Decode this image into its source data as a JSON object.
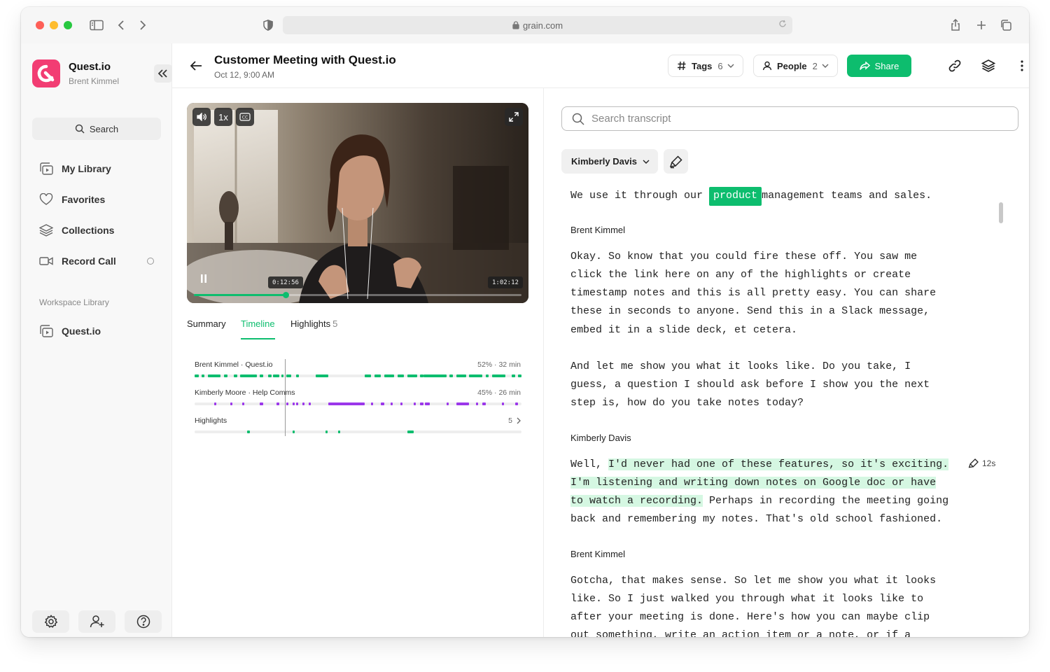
{
  "browser": {
    "url": "grain.com"
  },
  "sidebar": {
    "workspace_name": "Quest.io",
    "user_name": "Brent Kimmel",
    "search_label": "Search",
    "nav": [
      {
        "label": "My Library",
        "icon": "library-icon"
      },
      {
        "label": "Favorites",
        "icon": "heart-icon"
      },
      {
        "label": "Collections",
        "icon": "layers-icon"
      },
      {
        "label": "Record Call",
        "icon": "video-camera-icon"
      }
    ],
    "section_label": "Workspace Library",
    "workspace_items": [
      {
        "label": "Quest.io",
        "icon": "library-icon"
      }
    ]
  },
  "header": {
    "title": "Customer Meeting with Quest.io",
    "subtitle": "Oct 12, 9:00 AM",
    "tags_label": "Tags",
    "tags_count": "6",
    "people_label": "People",
    "people_count": "2",
    "share_label": "Share"
  },
  "video": {
    "speed_label": "1x",
    "current_time": "0:12:56",
    "duration": "1:02:12",
    "progress": 0.28
  },
  "tabs": [
    {
      "label": "Summary",
      "count": ""
    },
    {
      "label": "Timeline",
      "count": ""
    },
    {
      "label": "Highlights",
      "count": "5"
    }
  ],
  "timeline": {
    "rows": [
      {
        "label": "Brent Kimmel · Quest.io",
        "stat": "52% · 32 min"
      },
      {
        "label": "Kimberly Moore · Help Comms",
        "stat": "45% · 26 min"
      },
      {
        "label": "Highlights",
        "stat": "5"
      }
    ]
  },
  "transcript": {
    "search_placeholder": "Search transcript",
    "speaker_filter": "Kimberly Davis",
    "first_line": {
      "before": "We use it through our ",
      "tag": "product",
      "after": "management teams and sales."
    },
    "block1": {
      "speaker": "Brent Kimmel",
      "lines": [
        "Okay. So know that you could fire these off. You saw me",
        "click the link here on any of the highlights or create",
        "timestamp notes and this is all pretty easy. You can share",
        "these in seconds to anyone. Send this in a Slack message,",
        "embed it in a slide deck, et cetera.",
        "",
        "And let me show you what it looks like. Do you take, I",
        "guess, a question I should ask before I show you the next",
        "step is, how do you take notes today?"
      ]
    },
    "block2": {
      "speaker": "Kimberly Davis",
      "highlight_duration": "12s",
      "l1_plain": "Well, ",
      "l1_hl": "I'd never had one of these features, so it's exciting.",
      "l2_hl": "I'm listening and writing down notes on Google doc or have",
      "l3_hl": "to watch a recording.",
      "l3_plain": " Perhaps in recording the meeting going",
      "l4_plain": "back and remembering my notes. That's old school fashioned."
    },
    "block3": {
      "speaker": "Brent Kimmel",
      "lines": [
        "Gotcha, that makes sense. So let me show you what it looks",
        "like. So I just walked you through what it looks like to",
        "after your meeting is done. Here's how you can maybe clip",
        "out something, write an action item or a note, or if a"
      ]
    }
  },
  "colors": {
    "brand_green": "#0dbd6e",
    "logo_pink": "#f23d73",
    "speaker_purple": "#9b37ea",
    "highlight_bg": "#d5f7e2"
  }
}
